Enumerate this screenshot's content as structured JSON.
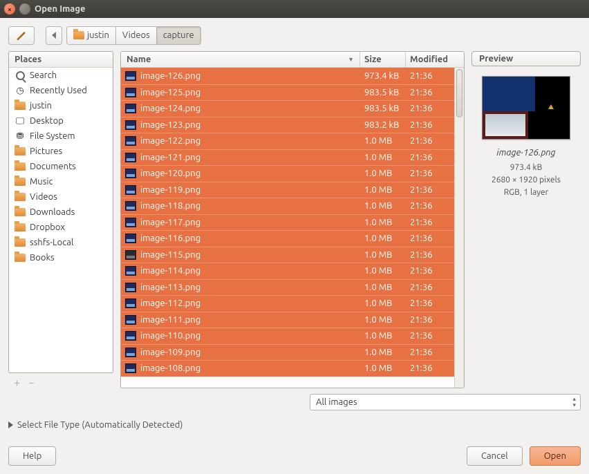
{
  "window": {
    "title": "Open Image"
  },
  "breadcrumbs": [
    {
      "label": "justin",
      "icon": "home-folder"
    },
    {
      "label": "Videos"
    },
    {
      "label": "capture"
    }
  ],
  "places": {
    "header": "Places",
    "items": [
      {
        "label": "Search",
        "icon": "search"
      },
      {
        "label": "Recently Used",
        "icon": "clock"
      },
      {
        "label": "justin",
        "icon": "home-folder"
      },
      {
        "label": "Desktop",
        "icon": "desktop"
      },
      {
        "label": "File System",
        "icon": "drive"
      },
      {
        "label": "Pictures",
        "icon": "folder"
      },
      {
        "label": "Documents",
        "icon": "folder"
      },
      {
        "label": "Music",
        "icon": "folder"
      },
      {
        "label": "Videos",
        "icon": "folder"
      },
      {
        "label": "Downloads",
        "icon": "folder"
      },
      {
        "label": "Dropbox",
        "icon": "folder"
      },
      {
        "label": "sshfs-Local",
        "icon": "folder"
      },
      {
        "label": "Books",
        "icon": "folder"
      }
    ]
  },
  "file_headers": {
    "name": "Name",
    "size": "Size",
    "modified": "Modified"
  },
  "files": [
    {
      "name": "image-126.png",
      "size": "973.4 kB",
      "modified": "21:36"
    },
    {
      "name": "image-125.png",
      "size": "983.5 kB",
      "modified": "21:36"
    },
    {
      "name": "image-124.png",
      "size": "983.5 kB",
      "modified": "21:36"
    },
    {
      "name": "image-123.png",
      "size": "983.2 kB",
      "modified": "21:36"
    },
    {
      "name": "image-122.png",
      "size": "1.0 MB",
      "modified": "21:36"
    },
    {
      "name": "image-121.png",
      "size": "1.0 MB",
      "modified": "21:36"
    },
    {
      "name": "image-120.png",
      "size": "1.0 MB",
      "modified": "21:36"
    },
    {
      "name": "image-119.png",
      "size": "1.0 MB",
      "modified": "21:36"
    },
    {
      "name": "image-118.png",
      "size": "1.0 MB",
      "modified": "21:36"
    },
    {
      "name": "image-117.png",
      "size": "1.0 MB",
      "modified": "21:36"
    },
    {
      "name": "image-116.png",
      "size": "1.0 MB",
      "modified": "21:36"
    },
    {
      "name": "image-115.png",
      "size": "1.0 MB",
      "modified": "21:36",
      "alt": true
    },
    {
      "name": "image-114.png",
      "size": "1.0 MB",
      "modified": "21:36"
    },
    {
      "name": "image-113.png",
      "size": "1.0 MB",
      "modified": "21:36"
    },
    {
      "name": "image-112.png",
      "size": "1.0 MB",
      "modified": "21:36"
    },
    {
      "name": "image-111.png",
      "size": "1.0 MB",
      "modified": "21:36"
    },
    {
      "name": "image-110.png",
      "size": "1.0 MB",
      "modified": "21:36"
    },
    {
      "name": "image-109.png",
      "size": "1.0 MB",
      "modified": "21:36"
    },
    {
      "name": "image-108.png",
      "size": "1.0 MB",
      "modified": "21:36"
    }
  ],
  "preview": {
    "header": "Preview",
    "filename": "image-126.png",
    "filesize": "973.4 kB",
    "dimensions": "2680 × 1920 pixels",
    "mode": "RGB, 1 layer"
  },
  "filter": {
    "selected": "All images"
  },
  "filetype": {
    "label": "Select File Type (Automatically Detected)"
  },
  "buttons": {
    "help": "Help",
    "cancel": "Cancel",
    "open": "Open"
  }
}
